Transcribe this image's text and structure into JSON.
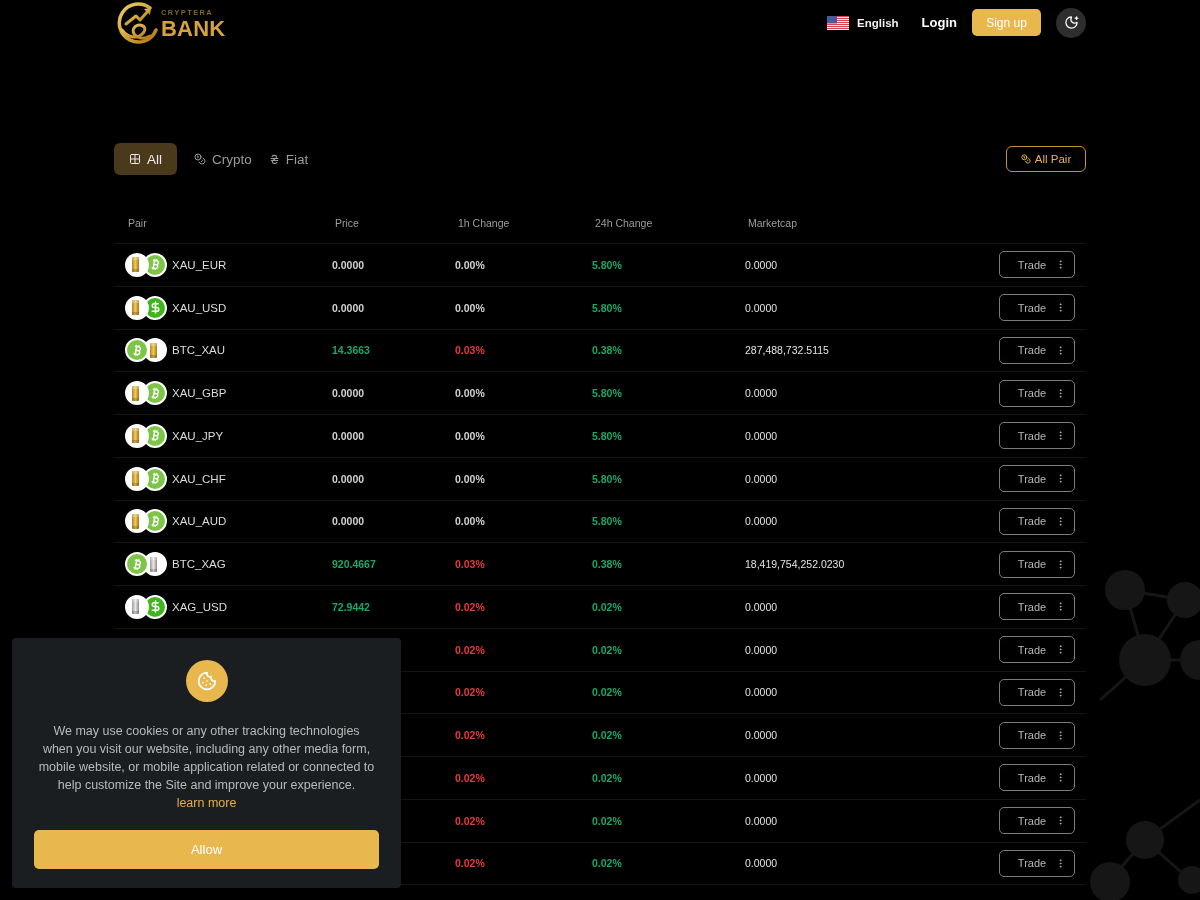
{
  "header": {
    "logo": {
      "tagline": "CRYPTERA",
      "name": "BANK"
    },
    "language": "English",
    "login": "Login",
    "signup": "Sign up"
  },
  "filters": {
    "tabs": [
      {
        "label": "All",
        "selected": true,
        "kind": "grid"
      },
      {
        "label": "Crypto",
        "selected": false,
        "kind": "coins"
      },
      {
        "label": "Fiat",
        "selected": false,
        "kind": "currency"
      }
    ],
    "all_pair_button": "All Pair"
  },
  "table": {
    "columns": [
      "Pair",
      "Price",
      "1h Change",
      "24h Change",
      "Marketcap"
    ],
    "rows": [
      {
        "pair": "XAU_EUR",
        "coins": [
          {
            "kind": "gold"
          },
          {
            "kind": "bitcoin"
          }
        ],
        "price": {
          "value": "0.0000",
          "color": "#d2d2d2"
        },
        "change_1h": {
          "value": "0.00%",
          "color": "#d2d2d2"
        },
        "change_24h": {
          "value": "5.80%",
          "color": "#17a867"
        },
        "marketcap": "0.0000",
        "action": "Trade"
      },
      {
        "pair": "XAU_USD",
        "coins": [
          {
            "kind": "gold"
          },
          {
            "kind": "dollar"
          }
        ],
        "price": {
          "value": "0.0000",
          "color": "#d2d2d2"
        },
        "change_1h": {
          "value": "0.00%",
          "color": "#d2d2d2"
        },
        "change_24h": {
          "value": "5.80%",
          "color": "#17a867"
        },
        "marketcap": "0.0000",
        "action": "Trade"
      },
      {
        "pair": "BTC_XAU",
        "coins": [
          {
            "kind": "bitcoin"
          },
          {
            "kind": "gold"
          }
        ],
        "price": {
          "value": "14.3663",
          "color": "#17a867"
        },
        "change_1h": {
          "value": "0.03%",
          "color": "#e5393b"
        },
        "change_24h": {
          "value": "0.38%",
          "color": "#17a867"
        },
        "marketcap": "287,488,732.5115",
        "action": "Trade"
      },
      {
        "pair": "XAU_GBP",
        "coins": [
          {
            "kind": "gold"
          },
          {
            "kind": "bitcoin"
          }
        ],
        "price": {
          "value": "0.0000",
          "color": "#d2d2d2"
        },
        "change_1h": {
          "value": "0.00%",
          "color": "#d2d2d2"
        },
        "change_24h": {
          "value": "5.80%",
          "color": "#17a867"
        },
        "marketcap": "0.0000",
        "action": "Trade"
      },
      {
        "pair": "XAU_JPY",
        "coins": [
          {
            "kind": "gold"
          },
          {
            "kind": "bitcoin"
          }
        ],
        "price": {
          "value": "0.0000",
          "color": "#d2d2d2"
        },
        "change_1h": {
          "value": "0.00%",
          "color": "#d2d2d2"
        },
        "change_24h": {
          "value": "5.80%",
          "color": "#17a867"
        },
        "marketcap": "0.0000",
        "action": "Trade"
      },
      {
        "pair": "XAU_CHF",
        "coins": [
          {
            "kind": "gold"
          },
          {
            "kind": "bitcoin"
          }
        ],
        "price": {
          "value": "0.0000",
          "color": "#d2d2d2"
        },
        "change_1h": {
          "value": "0.00%",
          "color": "#d2d2d2"
        },
        "change_24h": {
          "value": "5.80%",
          "color": "#17a867"
        },
        "marketcap": "0.0000",
        "action": "Trade"
      },
      {
        "pair": "XAU_AUD",
        "coins": [
          {
            "kind": "gold"
          },
          {
            "kind": "bitcoin"
          }
        ],
        "price": {
          "value": "0.0000",
          "color": "#d2d2d2"
        },
        "change_1h": {
          "value": "0.00%",
          "color": "#d2d2d2"
        },
        "change_24h": {
          "value": "5.80%",
          "color": "#17a867"
        },
        "marketcap": "0.0000",
        "action": "Trade"
      },
      {
        "pair": "BTC_XAG",
        "coins": [
          {
            "kind": "bitcoin"
          },
          {
            "kind": "silver"
          }
        ],
        "price": {
          "value": "920.4667",
          "color": "#17a867"
        },
        "change_1h": {
          "value": "0.03%",
          "color": "#e5393b"
        },
        "change_24h": {
          "value": "0.38%",
          "color": "#17a867"
        },
        "marketcap": "18,419,754,252.0230",
        "action": "Trade"
      },
      {
        "pair": "XAG_USD",
        "coins": [
          {
            "kind": "silver"
          },
          {
            "kind": "dollar"
          }
        ],
        "price": {
          "value": "72.9442",
          "color": "#17a867"
        },
        "change_1h": {
          "value": "0.02%",
          "color": "#e5393b"
        },
        "change_24h": {
          "value": "0.02%",
          "color": "#17a867"
        },
        "marketcap": "0.0000",
        "action": "Trade"
      },
      {
        "change_1h": {
          "value": "0.02%",
          "color": "#e5393b"
        },
        "change_24h": {
          "value": "0.02%",
          "color": "#17a867"
        },
        "marketcap": "0.0000",
        "action": "Trade"
      },
      {
        "change_1h": {
          "value": "0.02%",
          "color": "#e5393b"
        },
        "change_24h": {
          "value": "0.02%",
          "color": "#17a867"
        },
        "marketcap": "0.0000",
        "action": "Trade"
      },
      {
        "change_1h": {
          "value": "0.02%",
          "color": "#e5393b"
        },
        "change_24h": {
          "value": "0.02%",
          "color": "#17a867"
        },
        "marketcap": "0.0000",
        "action": "Trade"
      },
      {
        "change_1h": {
          "value": "0.02%",
          "color": "#e5393b"
        },
        "change_24h": {
          "value": "0.02%",
          "color": "#17a867"
        },
        "marketcap": "0.0000",
        "action": "Trade"
      },
      {
        "change_1h": {
          "value": "0.02%",
          "color": "#e5393b"
        },
        "change_24h": {
          "value": "0.02%",
          "color": "#17a867"
        },
        "marketcap": "0.0000",
        "action": "Trade"
      },
      {
        "change_1h": {
          "value": "0.02%",
          "color": "#e5393b"
        },
        "change_24h": {
          "value": "0.02%",
          "color": "#17a867"
        },
        "marketcap": "0.0000",
        "action": "Trade"
      }
    ]
  },
  "cookie_notice": {
    "text": "We may use cookies or any other tracking technologies when you visit our website, including any other media form, mobile website, or mobile application related or connected to help customize the Site and improve your experience.",
    "link": "learn more",
    "button": "Allow"
  }
}
